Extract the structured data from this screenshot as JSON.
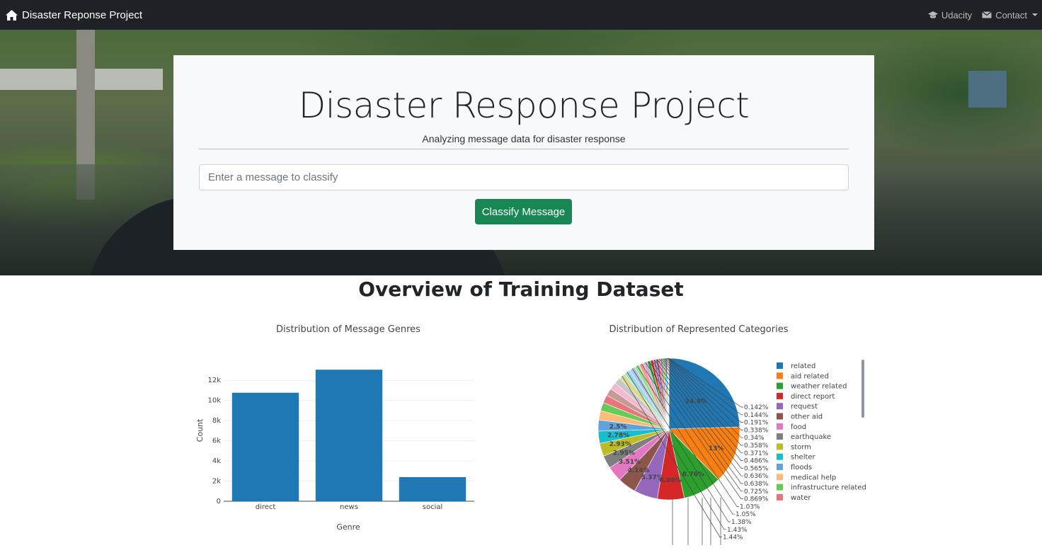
{
  "navbar": {
    "brand": "Disaster Reponse Project",
    "links": [
      {
        "label": "Udacity",
        "icon": "graduation-cap-icon"
      },
      {
        "label": "Contact",
        "icon": "envelope-icon"
      }
    ]
  },
  "hero": {
    "title": "Disaster Response Project",
    "subtitle": "Analyzing message data for disaster response",
    "input_placeholder": "Enter a message to classify",
    "button_label": "Classify Message"
  },
  "overview": {
    "title": "Overview of Training Dataset"
  },
  "colors": {
    "navbar_bg": "#1e2125",
    "button_green": "#198754",
    "bar_blue": "#1f77b4"
  },
  "chart_data": [
    {
      "type": "bar",
      "title": "Distribution of Message Genres",
      "xlabel": "Genre",
      "ylabel": "Count",
      "categories": [
        "direct",
        "news",
        "social"
      ],
      "values": [
        10766,
        13054,
        2396
      ],
      "ylim": [
        0,
        13700
      ],
      "yticks": [
        0,
        2000,
        4000,
        6000,
        8000,
        10000,
        12000
      ],
      "ytick_labels": [
        "0",
        "2k",
        "4k",
        "6k",
        "8k",
        "10k",
        "12k"
      ],
      "grid": true
    },
    {
      "type": "pie",
      "title": "Distribution of Represented Categories",
      "legend": [
        "related",
        "aid related",
        "weather related",
        "direct report",
        "request",
        "other aid",
        "food",
        "earthquake",
        "storm",
        "shelter",
        "floods",
        "medical help",
        "infrastructure related",
        "water"
      ],
      "slices": [
        {
          "label": "related",
          "percent": 24.3,
          "color": "#1f77b4"
        },
        {
          "label": "aid related",
          "percent": 13,
          "color": "#ff7f0e"
        },
        {
          "label": "weather related",
          "percent": 8.76,
          "color": "#2ca02c"
        },
        {
          "label": "direct report",
          "percent": 6.09,
          "color": "#d62728"
        },
        {
          "label": "request",
          "percent": 5.37,
          "color": "#9467bd"
        },
        {
          "label": "other aid",
          "percent": 4.14,
          "color": "#8c564b"
        },
        {
          "label": "food",
          "percent": 3.51,
          "color": "#e377c2"
        },
        {
          "label": "earthquake",
          "percent": 2.95,
          "color": "#7f7f7f"
        },
        {
          "label": "storm",
          "percent": 2.93,
          "color": "#bcbd22"
        },
        {
          "label": "shelter",
          "percent": 2.78,
          "color": "#17becf"
        },
        {
          "label": "floods",
          "percent": 2.5,
          "color": "#5fa2dd"
        },
        {
          "label": "medical help",
          "percent": 2.1,
          "color": "#ffbb78"
        },
        {
          "label": "infrastructure related",
          "percent": 1.9,
          "color": "#66cc55"
        },
        {
          "label": "water",
          "percent": 1.8,
          "color": "#e8747c"
        },
        {
          "label": "",
          "percent": 1.7,
          "color": "#c49c94"
        },
        {
          "label": "",
          "percent": 1.6,
          "color": "#f7b6d2"
        },
        {
          "label": "",
          "percent": 1.5,
          "color": "#c7c7c7"
        },
        {
          "label": "",
          "percent": 1.44,
          "color": "#dbdb8d"
        },
        {
          "label": "",
          "percent": 1.43,
          "color": "#9edae5"
        },
        {
          "label": "",
          "percent": 1.38,
          "color": "#aec7e8"
        },
        {
          "label": "",
          "percent": 1.05,
          "color": "#98df8a"
        },
        {
          "label": "",
          "percent": 1.03,
          "color": "#ff9896"
        },
        {
          "label": "",
          "percent": 0.869,
          "color": "#c5b0d5"
        },
        {
          "label": "",
          "percent": 0.725,
          "color": "#2ca02c"
        },
        {
          "label": "",
          "percent": 0.638,
          "color": "#d62728"
        },
        {
          "label": "",
          "percent": 0.636,
          "color": "#9467bd"
        },
        {
          "label": "",
          "percent": 0.565,
          "color": "#8c564b"
        },
        {
          "label": "",
          "percent": 0.486,
          "color": "#e377c2"
        },
        {
          "label": "",
          "percent": 0.371,
          "color": "#7f7f7f"
        },
        {
          "label": "",
          "percent": 0.358,
          "color": "#bcbd22"
        },
        {
          "label": "",
          "percent": 0.34,
          "color": "#17becf"
        },
        {
          "label": "",
          "percent": 0.338,
          "color": "#1f77b4"
        },
        {
          "label": "",
          "percent": 0.191,
          "color": "#ff7f0e"
        },
        {
          "label": "",
          "percent": 0.144,
          "color": "#2ca02c"
        },
        {
          "label": "",
          "percent": 0.142,
          "color": "#d62728"
        }
      ],
      "outside_labels": [
        "0.142%",
        "0.144%",
        "0.191%",
        "0.338%",
        "0.34%",
        "0.358%",
        "0.371%",
        "0.486%",
        "0.565%",
        "0.636%",
        "0.638%",
        "0.725%",
        "0.869%",
        "1.03%",
        "1.05%",
        "1.38%",
        "1.43%",
        "1.44%"
      ],
      "inside_labels": [
        "24.3%",
        "13%",
        "8.76%",
        "6.09%",
        "5.37%",
        "4.14%",
        "3.51%",
        "2.95%",
        "2.93%",
        "2.78%",
        "2.5%"
      ]
    }
  ]
}
